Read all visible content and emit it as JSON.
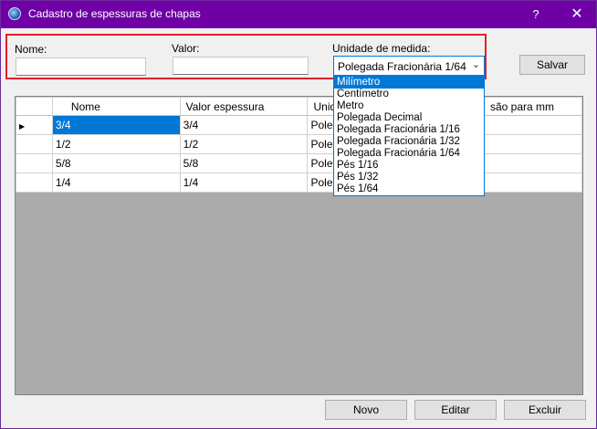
{
  "window": {
    "title": "Cadastro de espessuras de chapas",
    "help": "?",
    "close": "✕"
  },
  "form": {
    "nome_label": "Nome:",
    "nome_value": "",
    "valor_label": "Valor:",
    "valor_value": "",
    "unidade_label": "Unidade de medida:",
    "unidade_selected": "Polegada Fracionária 1/64",
    "unidade_options": [
      "Milímetro",
      "Centímetro",
      "Metro",
      "Polegada Decimal",
      "Polegada Fracionária 1/16",
      "Polegada Fracionária 1/32",
      "Polegada Fracionária 1/64",
      "Pés 1/16",
      "Pés 1/32",
      "Pés 1/64"
    ],
    "salvar": "Salvar"
  },
  "grid": {
    "columns": [
      "",
      "Nome",
      "Valor espessura",
      "Unid",
      "são para mm"
    ],
    "rows": [
      {
        "indicator": "▶",
        "nome": "3/4",
        "valor": "3/4",
        "unidade": "Poleg",
        "conv": ""
      },
      {
        "indicator": "",
        "nome": "1/2",
        "valor": "1/2",
        "unidade": "Poleg",
        "conv": ""
      },
      {
        "indicator": "",
        "nome": "5/8",
        "valor": "5/8",
        "unidade": "Poleg",
        "conv": ""
      },
      {
        "indicator": "",
        "nome": "1/4",
        "valor": "1/4",
        "unidade": "Poleg",
        "conv": ""
      }
    ]
  },
  "footer": {
    "novo": "Novo",
    "editar": "Editar",
    "excluir": "Excluir"
  }
}
